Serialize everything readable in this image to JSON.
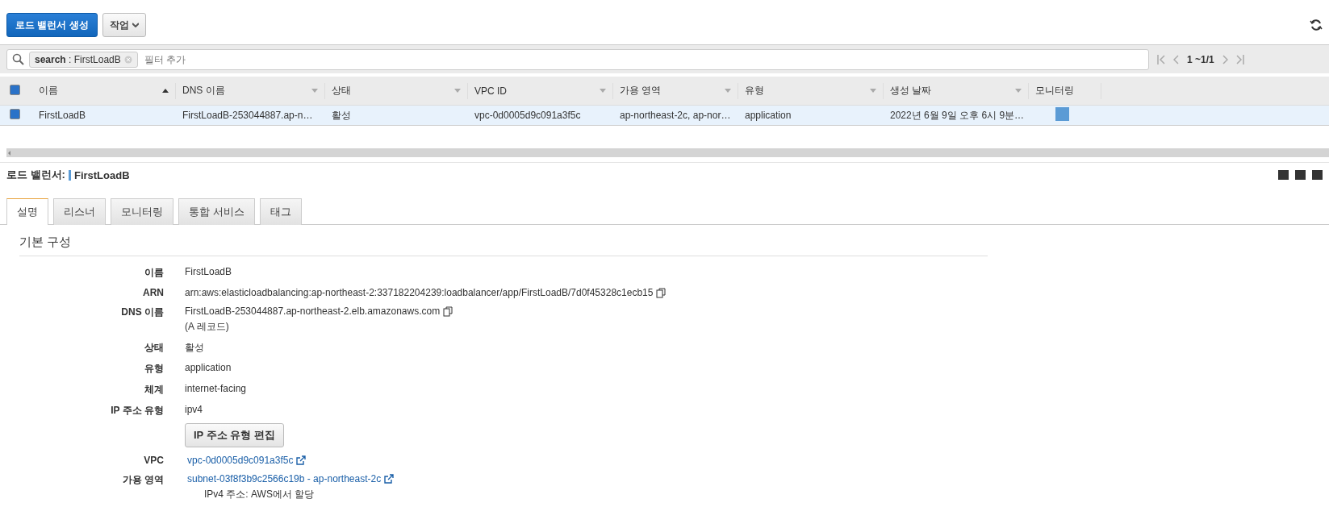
{
  "toolbar": {
    "create_button": "로드 밸런서 생성",
    "actions_button": "작업"
  },
  "filter": {
    "token": "**search** : FirstLoadB",
    "placeholder": "필터 추가",
    "pagination": "1 ~1/1"
  },
  "table": {
    "columns": [
      {
        "label": "이름",
        "sortable": true,
        "sorted": true
      },
      {
        "label": "DNS 이름",
        "sortable": true,
        "sorted": false
      },
      {
        "label": "상태",
        "sortable": true,
        "sorted": false
      },
      {
        "label": "VPC ID",
        "sortable": true,
        "sorted": false
      },
      {
        "label": "가용 영역",
        "sortable": true,
        "sorted": false
      },
      {
        "label": "유형",
        "sortable": true,
        "sorted": false
      },
      {
        "label": "생성 날짜",
        "sortable": true,
        "sorted": false
      },
      {
        "label": "모니터링",
        "sortable": false
      }
    ],
    "all_checked": true,
    "rows": [
      {
        "selected": true,
        "cells": [
          "FirstLoadB",
          "FirstLoadB-253044887.ap-n…",
          "활성",
          "vpc-0d0005d9c091a3f5c",
          "ap-northeast-2c, ap-nor…",
          "application",
          "2022년 6월 9일 오후 6시 9분…"
        ]
      }
    ]
  },
  "detail": {
    "label": "로드 밸런서:",
    "name": "FirstLoadB",
    "tabs": [
      {
        "label": "설명",
        "selected": true
      },
      {
        "label": "리스너",
        "selected": false
      },
      {
        "label": "모니터링",
        "selected": false
      },
      {
        "label": "통합 서비스",
        "selected": false
      },
      {
        "label": "태그",
        "selected": false
      }
    ],
    "section_title": "기본 구성",
    "fields": [
      {
        "kind": "text",
        "label": "이름",
        "value": "FirstLoadB"
      },
      {
        "kind": "text",
        "label": "ARN",
        "value": "arn:aws:elasticloadbalancing:ap-northeast-2:337182204239:loadbalancer/app/FirstLoadB/7d0f45328c1ecb15",
        "copyable": true
      },
      {
        "kind": "text",
        "label": "DNS 이름",
        "value": "FirstLoadB-253044887.ap-northeast-2.elb.amazonaws.com",
        "copyable": true,
        "note": "(A 레코드)"
      },
      {
        "kind": "text",
        "label": "상태",
        "value": "활성"
      },
      {
        "kind": "text",
        "label": "유형",
        "value": "application"
      },
      {
        "kind": "text",
        "label": "체계",
        "value": "internet-facing"
      },
      {
        "kind": "text",
        "label": "IP 주소 유형",
        "value": "ipv4"
      },
      {
        "kind": "button",
        "value": "IP 주소 유형 편집"
      },
      {
        "kind": "link",
        "label": "VPC",
        "value": "vpc-0d0005d9c091a3f5c"
      },
      {
        "kind": "link",
        "label": "가용 영역",
        "value": "subnet-03f8f3b9c2566c19b - ap-northeast-2c",
        "note": "IPv4 주소: AWS에서 할당"
      }
    ]
  }
}
